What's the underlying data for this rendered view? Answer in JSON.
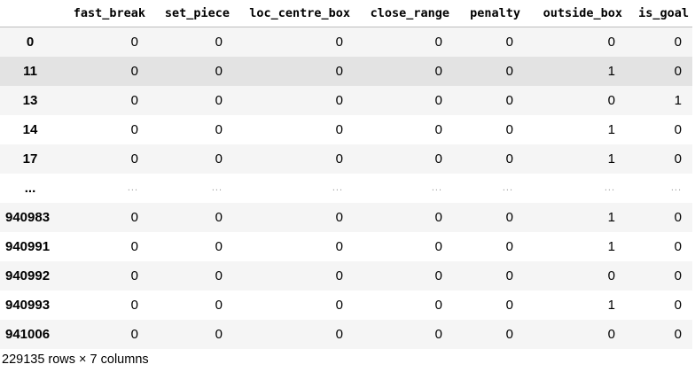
{
  "dataframe": {
    "columns": [
      "fast_break",
      "set_piece",
      "loc_centre_box",
      "close_range",
      "penalty",
      "outside_box",
      "is_goal"
    ],
    "rows": [
      {
        "index": "0",
        "values": [
          "0",
          "0",
          "0",
          "0",
          "0",
          "0",
          "0"
        ]
      },
      {
        "index": "11",
        "values": [
          "0",
          "0",
          "0",
          "0",
          "0",
          "1",
          "0"
        ]
      },
      {
        "index": "13",
        "values": [
          "0",
          "0",
          "0",
          "0",
          "0",
          "0",
          "1"
        ]
      },
      {
        "index": "14",
        "values": [
          "0",
          "0",
          "0",
          "0",
          "0",
          "1",
          "0"
        ]
      },
      {
        "index": "17",
        "values": [
          "0",
          "0",
          "0",
          "0",
          "0",
          "1",
          "0"
        ]
      },
      {
        "index": "...",
        "values": [
          "...",
          "...",
          "...",
          "...",
          "...",
          "...",
          "..."
        ]
      },
      {
        "index": "940983",
        "values": [
          "0",
          "0",
          "0",
          "0",
          "0",
          "1",
          "0"
        ]
      },
      {
        "index": "940991",
        "values": [
          "0",
          "0",
          "0",
          "0",
          "0",
          "1",
          "0"
        ]
      },
      {
        "index": "940992",
        "values": [
          "0",
          "0",
          "0",
          "0",
          "0",
          "0",
          "0"
        ]
      },
      {
        "index": "940993",
        "values": [
          "0",
          "0",
          "0",
          "0",
          "0",
          "1",
          "0"
        ]
      },
      {
        "index": "941006",
        "values": [
          "0",
          "0",
          "0",
          "0",
          "0",
          "0",
          "0"
        ]
      }
    ],
    "shape_text": "229135 rows × 7 columns",
    "colors": {
      "striped_row": "#f5f5f5",
      "hovered_row": "#e3e3e3",
      "header_border": "#bdbdbd",
      "ellipsis_text": "#9a9a9a"
    },
    "hovered_row_index": "11"
  }
}
